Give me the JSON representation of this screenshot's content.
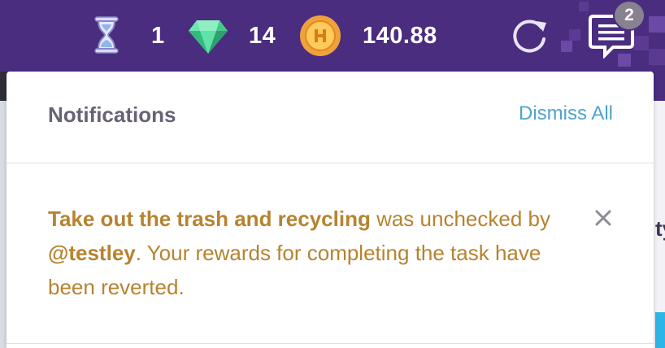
{
  "header": {
    "hourglass": {
      "icon": "hourglass-icon",
      "value": "1"
    },
    "gems": {
      "icon": "gem-icon",
      "value": "14"
    },
    "gold": {
      "icon": "gold-coin-icon",
      "value": "140.88"
    },
    "refresh_icon": "refresh-icon",
    "notifications_icon": "notifications-icon",
    "notifications_badge": "2"
  },
  "page": {
    "partial_text": "ty"
  },
  "notifications": {
    "title": "Notifications",
    "dismiss_all_label": "Dismiss All",
    "items": [
      {
        "task_name": "Take out the trash and recycling",
        "text_after_task": " was unchecked by ",
        "user": "@testley",
        "text_after_user": ". Your rewards for completing the task have been reverted.",
        "dismiss_icon": "close-icon"
      }
    ]
  },
  "colors": {
    "header_bg": "#4a2d7f",
    "panel_bg": "#ffffff",
    "title_text": "#686274",
    "link": "#4fa3cf",
    "notification_text": "#b7832f",
    "badge_bg": "#878190"
  }
}
